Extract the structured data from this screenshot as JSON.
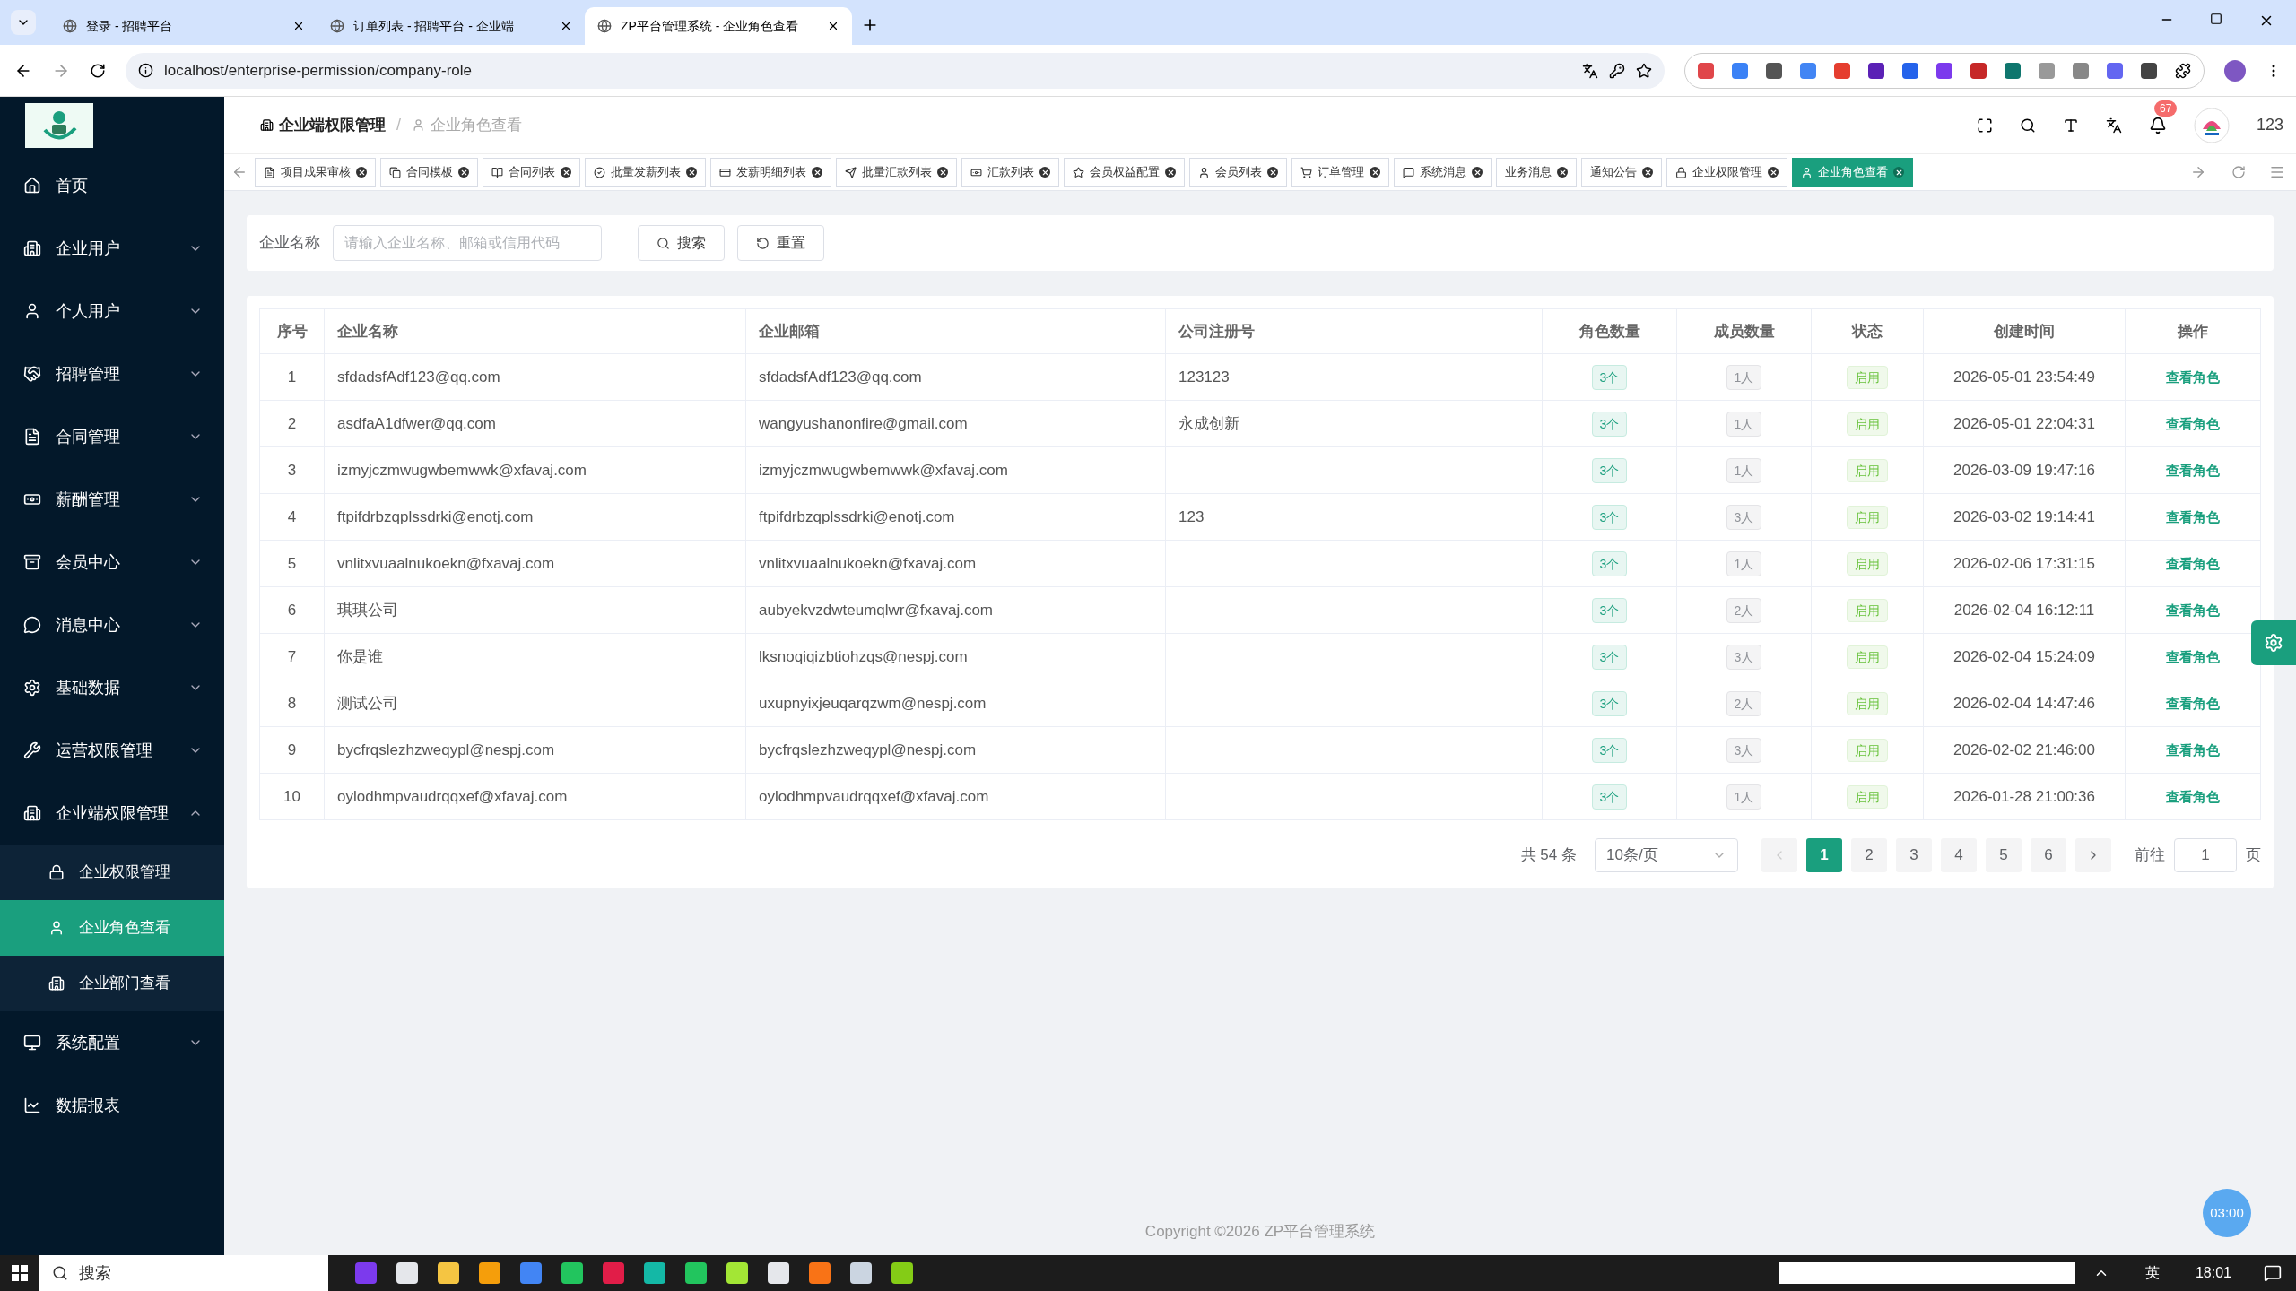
{
  "browser": {
    "tabs": [
      {
        "title": "登录 - 招聘平台",
        "selected": false
      },
      {
        "title": "订单列表 - 招聘平台 - 企业端",
        "selected": false
      },
      {
        "title": "ZP平台管理系统 - 企业角色查看",
        "selected": true
      }
    ],
    "url": "localhost/enterprise-permission/company-role"
  },
  "sidebar": {
    "items": [
      {
        "label": "首页",
        "kind": "link"
      },
      {
        "label": "企业用户",
        "kind": "group",
        "expanded": false
      },
      {
        "label": "个人用户",
        "kind": "group",
        "expanded": false
      },
      {
        "label": "招聘管理",
        "kind": "group",
        "expanded": false
      },
      {
        "label": "合同管理",
        "kind": "group",
        "expanded": false
      },
      {
        "label": "薪酬管理",
        "kind": "group",
        "expanded": false
      },
      {
        "label": "会员中心",
        "kind": "group",
        "expanded": false
      },
      {
        "label": "消息中心",
        "kind": "group",
        "expanded": false
      },
      {
        "label": "基础数据",
        "kind": "group",
        "expanded": false
      },
      {
        "label": "运营权限管理",
        "kind": "group",
        "expanded": false
      },
      {
        "label": "企业端权限管理",
        "kind": "group",
        "expanded": true,
        "children": [
          {
            "label": "企业权限管理",
            "selected": false
          },
          {
            "label": "企业角色查看",
            "selected": true
          },
          {
            "label": "企业部门查看",
            "selected": false
          }
        ]
      },
      {
        "label": "系统配置",
        "kind": "group",
        "expanded": false
      },
      {
        "label": "数据报表",
        "kind": "link"
      }
    ]
  },
  "header": {
    "breadcrumb": [
      "企业端权限管理",
      "企业角色查看"
    ],
    "breadcrumb_separator": "/",
    "notification_count": "67",
    "user": "123"
  },
  "tags": [
    {
      "label": "项目成果审核",
      "selected": false
    },
    {
      "label": "合同模板",
      "selected": false
    },
    {
      "label": "合同列表",
      "selected": false
    },
    {
      "label": "批量发薪列表",
      "selected": false
    },
    {
      "label": "发薪明细列表",
      "selected": false
    },
    {
      "label": "批量汇款列表",
      "selected": false
    },
    {
      "label": "汇款列表",
      "selected": false
    },
    {
      "label": "会员权益配置",
      "selected": false
    },
    {
      "label": "会员列表",
      "selected": false
    },
    {
      "label": "订单管理",
      "selected": false
    },
    {
      "label": "系统消息",
      "selected": false
    },
    {
      "label": "业务消息",
      "selected": false
    },
    {
      "label": "通知公告",
      "selected": false
    },
    {
      "label": "企业权限管理",
      "selected": false
    },
    {
      "label": "企业角色查看",
      "selected": true
    }
  ],
  "search": {
    "label": "企业名称",
    "placeholder": "请输入企业名称、邮箱或信用代码",
    "buttons": [
      "搜索",
      "重置"
    ]
  },
  "table": {
    "columns": [
      "序号",
      "企业名称",
      "企业邮箱",
      "公司注册号",
      "角色数量",
      "成员数量",
      "状态",
      "创建时间",
      "操作"
    ],
    "rows": [
      {
        "index": "1",
        "name": "sfdadsfAdf123@qq.com",
        "email": "sfdadsfAdf123@qq.com",
        "registration": "123123",
        "roles": "3个",
        "members": "1人",
        "status": "启用",
        "created": "2026-05-01 23:54:49",
        "action": "查看角色"
      },
      {
        "index": "2",
        "name": "asdfaA1dfwer@qq.com",
        "email": "wangyushanonfire@gmail.com",
        "registration": "永成创新",
        "roles": "3个",
        "members": "1人",
        "status": "启用",
        "created": "2026-05-01 22:04:31",
        "action": "查看角色"
      },
      {
        "index": "3",
        "name": "izmyjczmwugwbemwwk@xfavaj.com",
        "email": "izmyjczmwugwbemwwk@xfavaj.com",
        "roles": "3个",
        "members": "1人",
        "status": "启用",
        "created": "2026-03-09 19:47:16",
        "action": "查看角色"
      },
      {
        "index": "4",
        "name": "ftpifdrbzqplssdrki@enotj.com",
        "email": "ftpifdrbzqplssdrki@enotj.com",
        "registration": "123",
        "roles": "3个",
        "members": "3人",
        "status": "启用",
        "created": "2026-03-02 19:14:41",
        "action": "查看角色"
      },
      {
        "index": "5",
        "name": "vnlitxvuaalnukoekn@fxavaj.com",
        "email": "vnlitxvuaalnukoekn@fxavaj.com",
        "roles": "3个",
        "members": "1人",
        "status": "启用",
        "created": "2026-02-06 17:31:15",
        "action": "查看角色"
      },
      {
        "index": "6",
        "name": "琪琪公司",
        "email": "aubyekvzdwteumqlwr@fxavaj.com",
        "roles": "3个",
        "members": "2人",
        "status": "启用",
        "created": "2026-02-04 16:12:11",
        "action": "查看角色"
      },
      {
        "index": "7",
        "name": "你是谁",
        "email": "lksnoqiqizbtiohzqs@nespj.com",
        "roles": "3个",
        "members": "3人",
        "status": "启用",
        "created": "2026-02-04 15:24:09",
        "action": "查看角色"
      },
      {
        "index": "8",
        "name": "测试公司",
        "email": "uxupnyixjeuqarqzwm@nespj.com",
        "roles": "3个",
        "members": "2人",
        "status": "启用",
        "created": "2026-02-04 14:47:46",
        "action": "查看角色"
      },
      {
        "index": "9",
        "name": "bycfrqslezhzweqypl@nespj.com",
        "email": "bycfrqslezhzweqypl@nespj.com",
        "roles": "3个",
        "members": "3人",
        "status": "启用",
        "created": "2026-02-02 21:46:00",
        "action": "查看角色"
      },
      {
        "index": "10",
        "name": "oylodhmpvaudrqqxef@xfavaj.com",
        "email": "oylodhmpvaudrqqxef@xfavaj.com",
        "roles": "3个",
        "members": "1人",
        "status": "启用",
        "created": "2026-01-28 21:00:36",
        "action": "查看角色"
      }
    ]
  },
  "pagination": {
    "total": "共 54 条",
    "page_size": "10条/页",
    "pages": [
      {
        "label": "1",
        "selected": true
      },
      {
        "label": "2",
        "selected": false
      },
      {
        "label": "3",
        "selected": false
      },
      {
        "label": "4",
        "selected": false
      },
      {
        "label": "5",
        "selected": false
      },
      {
        "label": "6",
        "selected": false
      }
    ],
    "goto_label": "前往",
    "goto_value": "1",
    "goto_suffix": "页"
  },
  "footer": "Copyright ©2026 ZP平台管理系统",
  "timer": "03:00",
  "taskbar": {
    "search": "搜索",
    "ime": "英",
    "time": "18:01"
  }
}
